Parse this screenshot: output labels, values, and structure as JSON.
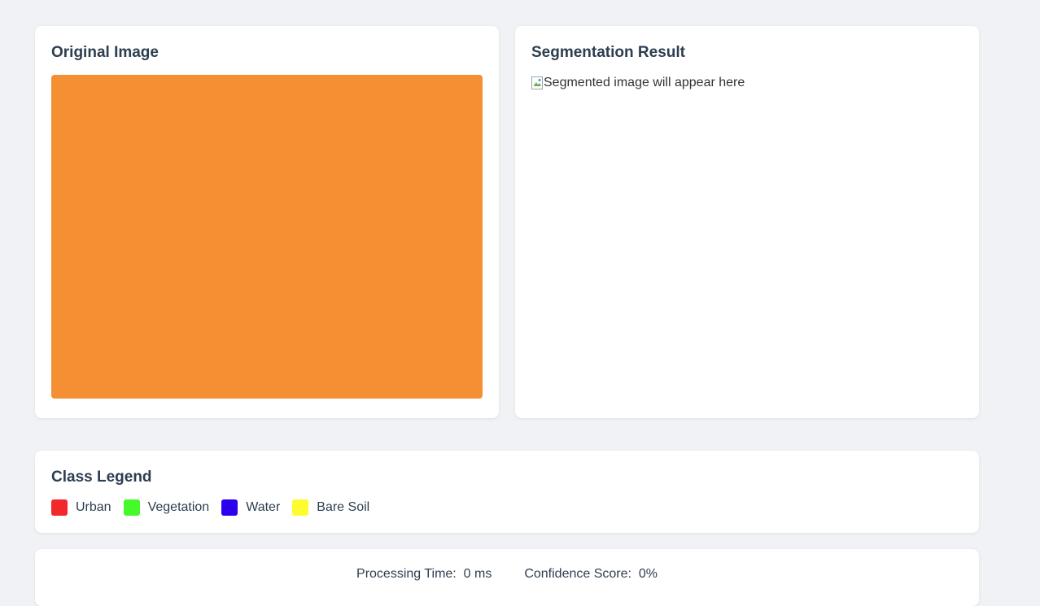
{
  "original_card": {
    "title": "Original Image",
    "image_color": "#f48f34"
  },
  "result_card": {
    "title": "Segmentation Result",
    "image_alt": "Segmented image will appear here"
  },
  "legend_card": {
    "title": "Class Legend",
    "items": [
      {
        "label": "Urban",
        "color": "#f2282a"
      },
      {
        "label": "Vegetation",
        "color": "#46f92a"
      },
      {
        "label": "Water",
        "color": "#2c00ef"
      },
      {
        "label": "Bare Soil",
        "color": "#fcfc2e"
      }
    ]
  },
  "stats_card": {
    "processing_time_label": "Processing Time:",
    "processing_time_value": "0 ms",
    "confidence_label": "Confidence Score:",
    "confidence_value": "0%"
  }
}
